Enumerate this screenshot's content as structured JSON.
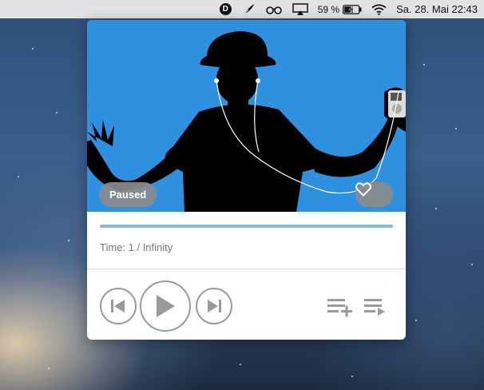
{
  "menubar": {
    "app_icon_letter": "D",
    "battery_label": "59 %",
    "datetime": "Sa. 28. Mai  22:43",
    "icons": [
      "d-app-icon",
      "feather-icon",
      "glasses-icon",
      "airplay-icon",
      "battery-charging-icon",
      "wifi-icon"
    ]
  },
  "player": {
    "state_badge": "Paused",
    "progress_fraction": 1.0,
    "time_text": "Time: 1 / Infinity",
    "artwork_color": "#2f90df",
    "accent_color": "#86b8e4",
    "controls": [
      "previous-track-icon",
      "play-icon",
      "next-track-icon",
      "add-to-queue-icon",
      "play-queue-icon",
      "heart-icon"
    ]
  }
}
